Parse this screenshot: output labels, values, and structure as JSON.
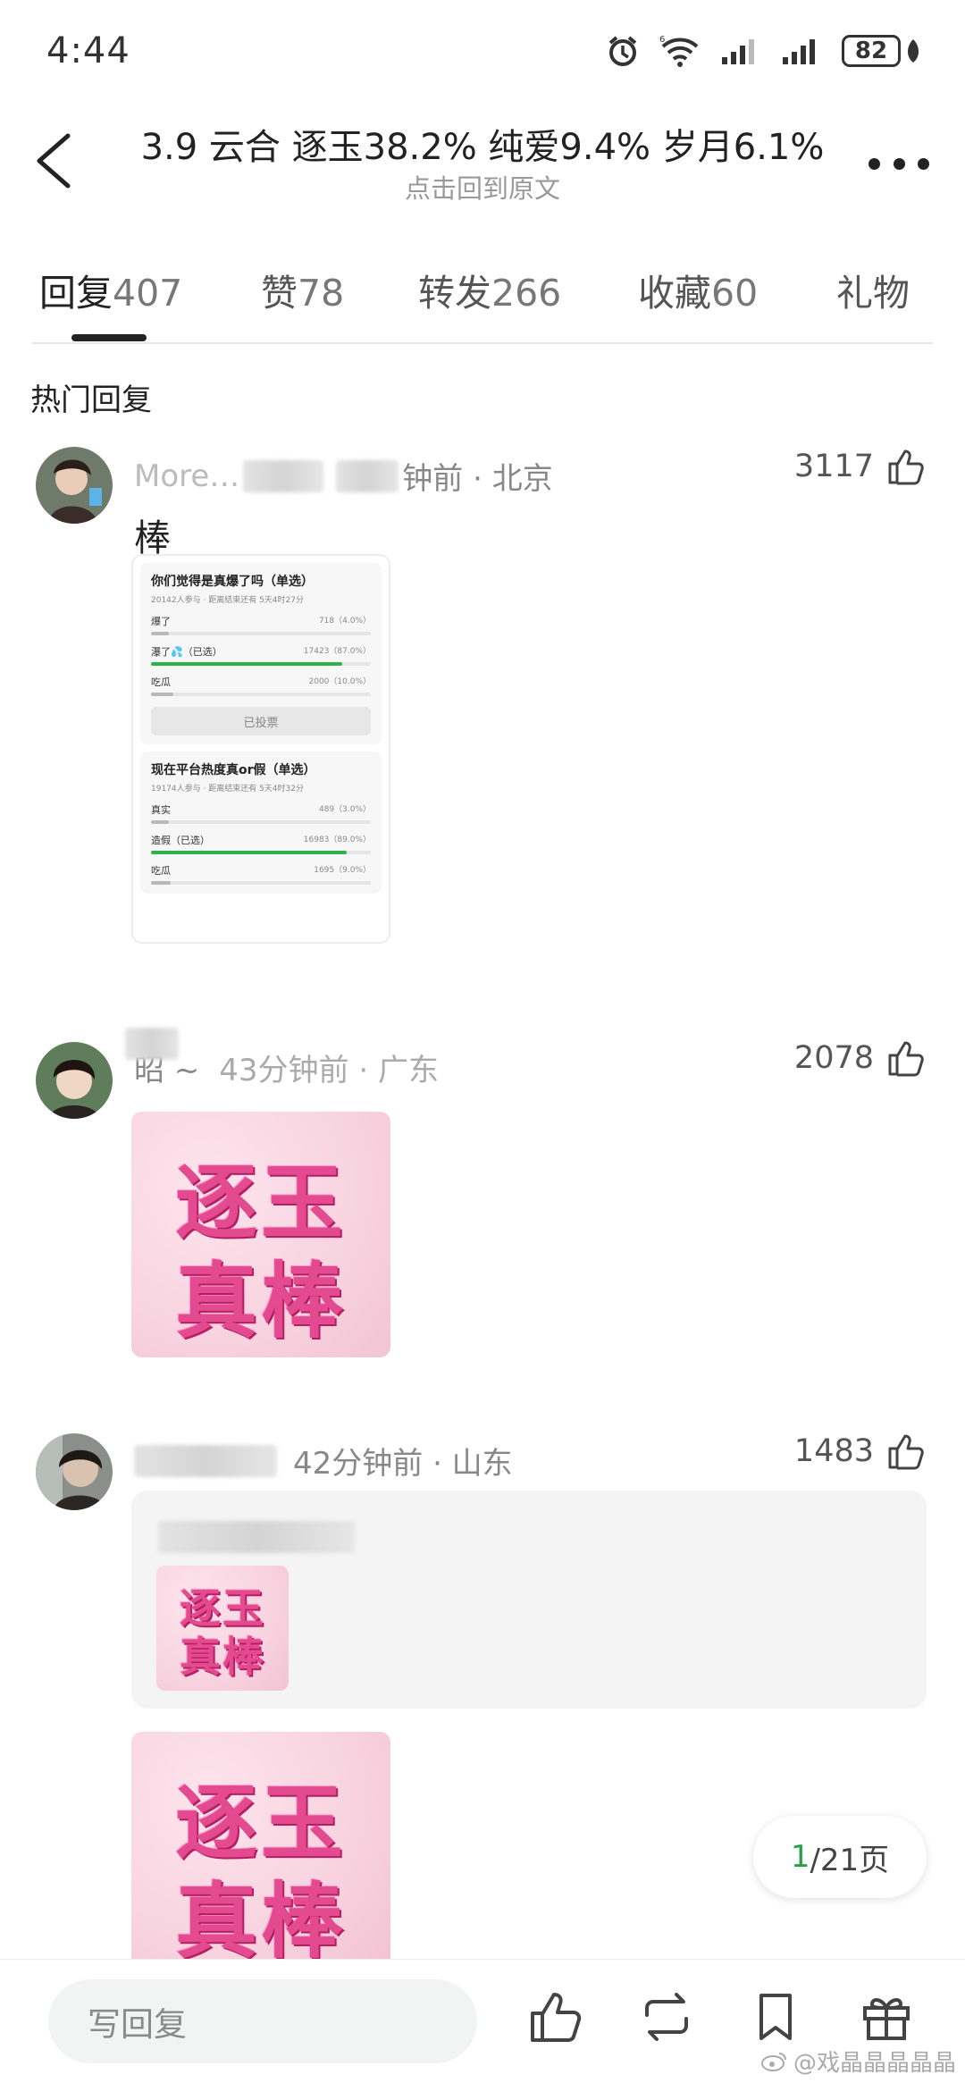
{
  "status_bar": {
    "time": "4:44",
    "battery": "82"
  },
  "header": {
    "title": "3.9 云合 逐玉38.2% 纯爱9.4% 岁月6.1%",
    "subtitle": "点击回到原文"
  },
  "tabs": [
    {
      "label": "回复",
      "count": "407"
    },
    {
      "label": "赞",
      "count": "78"
    },
    {
      "label": "转发",
      "count": "266"
    },
    {
      "label": "收藏",
      "count": "60"
    },
    {
      "label": "礼物",
      "count": ""
    }
  ],
  "section_title": "热门回复",
  "comments": [
    {
      "name_fragment": "More…",
      "time_location": "钟前 · 北京",
      "likes": "3117",
      "text": "棒",
      "poll": [
        {
          "title": "你们觉得是真爆了吗（单选）",
          "info": "20142人参与 · 距离结束还有 5天4时27分",
          "options": [
            {
              "label": "爆了",
              "pct": "718（4.0%）",
              "fill": 0.04,
              "selected": false
            },
            {
              "label": "瀑了💦（已选）",
              "pct": "17423（87.0%）",
              "fill": 0.87,
              "selected": true
            },
            {
              "label": "吃瓜",
              "pct": "2000（10.0%）",
              "fill": 0.1,
              "selected": false
            }
          ],
          "voted_label": "已投票"
        },
        {
          "title": "现在平台热度真or假（单选）",
          "info": "19174人参与 · 距离结束还有 5天4时32分",
          "options": [
            {
              "label": "真实",
              "pct": "489（3.0%）",
              "fill": 0.03,
              "selected": false
            },
            {
              "label": "造假（已选）",
              "pct": "16983（89.0%）",
              "fill": 0.89,
              "selected": true
            },
            {
              "label": "吃瓜",
              "pct": "1695（9.0%）",
              "fill": 0.09,
              "selected": false
            }
          ]
        }
      ]
    },
    {
      "name_fragment": "昭 ~",
      "time_location": "43分钟前 · 广东",
      "likes": "2078",
      "sticker": {
        "line1": "逐玉",
        "line2": "真棒"
      }
    },
    {
      "name_fragment": "",
      "time_location": "42分钟前 · 山东",
      "likes": "1483",
      "quoted_sticker": {
        "line1": "逐玉",
        "line2": "真棒"
      },
      "sticker": {
        "line1": "逐玉",
        "line2": "真棒"
      }
    }
  ],
  "page_indicator": {
    "current": "1",
    "total": "/21页"
  },
  "bottom_bar": {
    "reply_placeholder": "写回复"
  },
  "watermark": "@戏晶晶晶晶晶",
  "colors": {
    "accent_green": "#2aa04a",
    "sticker_pink": "#e44a8f"
  }
}
